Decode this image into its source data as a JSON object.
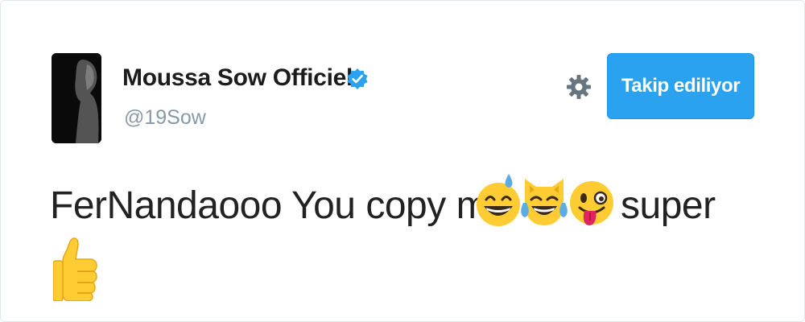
{
  "profile": {
    "display_name": "Moussa Sow Officiel",
    "handle": "@19Sow",
    "verified": true,
    "avatar_icon": "profile-photo"
  },
  "actions": {
    "settings_icon": "gear-icon",
    "follow_label": "Takip ediliyor"
  },
  "tweet": {
    "text_part1": "FerNandaooo You copy me",
    "emojis": [
      "grinning-sweat-emoji",
      "tears-of-joy-cat-emoji",
      "winking-tongue-emoji"
    ],
    "text_part2": "super",
    "trailing_emoji": "thumbs-up-emoji"
  },
  "colors": {
    "accent": "#2aa2ef",
    "handle_gray": "#8899a6",
    "text": "#222222"
  }
}
